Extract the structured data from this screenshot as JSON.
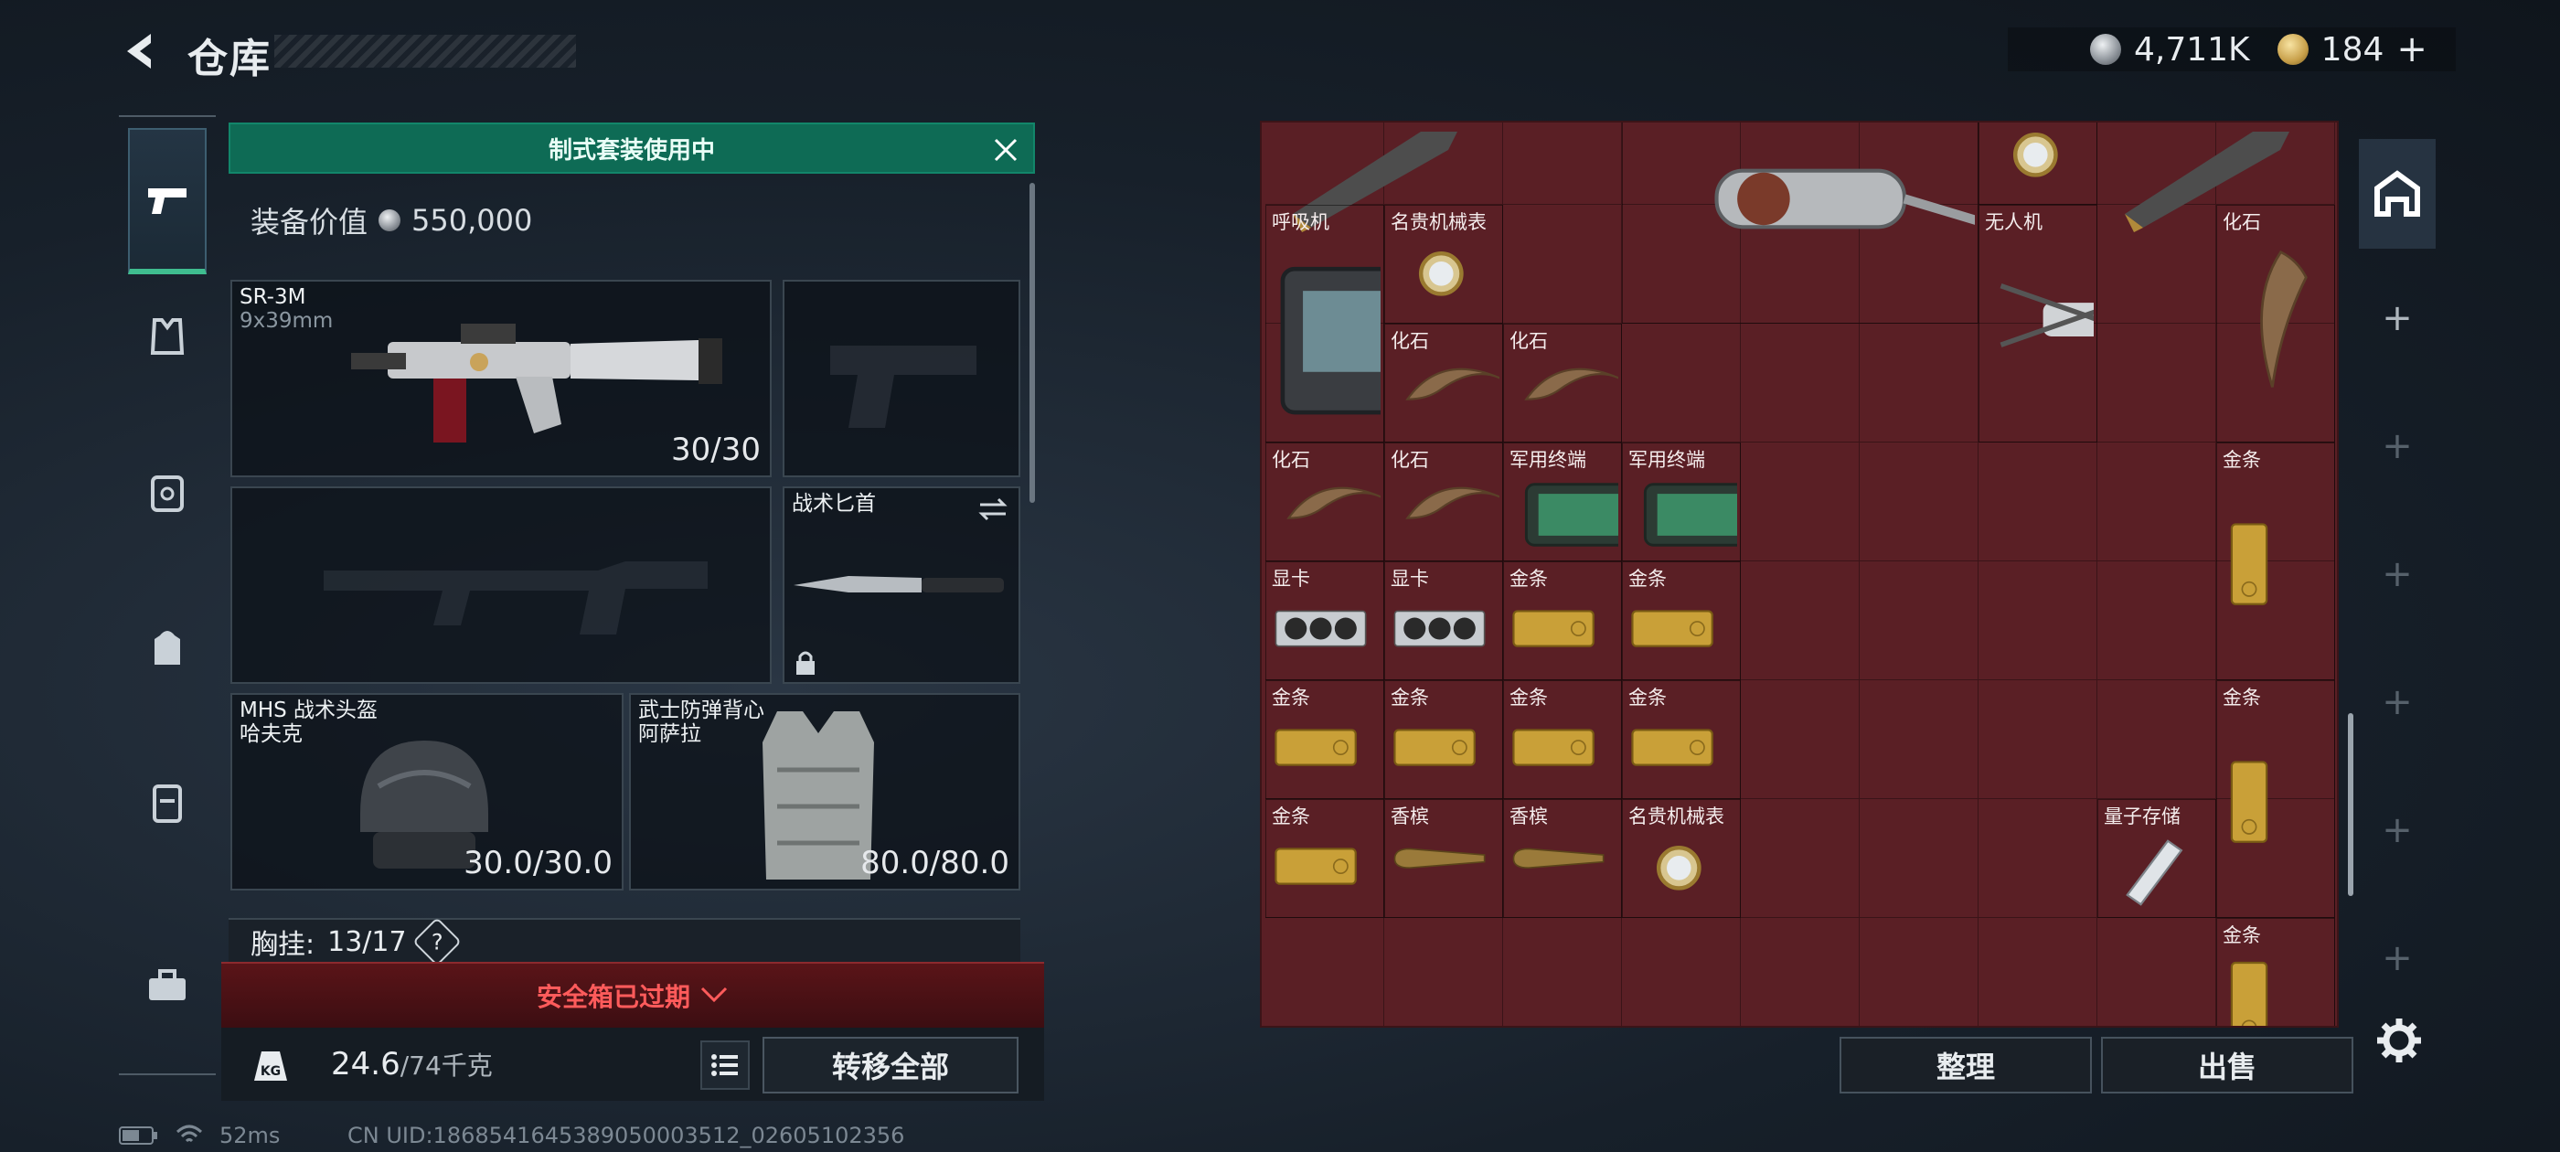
{
  "header": {
    "title": "仓库",
    "currency_silver": "4,711K",
    "currency_gold": "184"
  },
  "nav": [
    "firearm",
    "armor",
    "safe-box",
    "backpack",
    "chest-rig",
    "toolbox"
  ],
  "loadout": {
    "banner": "制式套装使用中",
    "equip_value_label": "装备价值",
    "equip_value": "550,000",
    "primary": {
      "name": "SR-3M",
      "caliber": "9x39mm",
      "ammo": "30/30"
    },
    "knife": {
      "name": "战术匕首"
    },
    "helmet": {
      "name": "MHS 战术头盔",
      "brand": "哈夫克",
      "durability": "30.0/30.0"
    },
    "vest": {
      "name": "武士防弹背心",
      "brand": "阿萨拉",
      "durability": "80.0/80.0"
    },
    "chest_label": "胸挂:",
    "chest_count": "13/17",
    "help": "?",
    "safebox_status": "安全箱已过期",
    "weight": "24.6",
    "weight_max": "/74千克",
    "transfer_all": "转移全部"
  },
  "stash": {
    "items": [
      {
        "label": "强力吸尘器",
        "kind": "vacuum"
      },
      {
        "label": "名贵机械表",
        "kind": "watch"
      },
      {
        "label": "呼吸机",
        "kind": "ventilator"
      },
      {
        "label": "名贵机械表",
        "kind": "watch"
      },
      {
        "label": "无人机",
        "kind": "drone"
      },
      {
        "label": "化石",
        "kind": "fossil-v"
      },
      {
        "label": "化石",
        "kind": "fossil"
      },
      {
        "label": "化石",
        "kind": "fossil"
      },
      {
        "label": "化石",
        "kind": "fossil"
      },
      {
        "label": "化石",
        "kind": "fossil"
      },
      {
        "label": "军用终端",
        "kind": "terminal"
      },
      {
        "label": "军用终端",
        "kind": "terminal"
      },
      {
        "label": "金条",
        "kind": "gold-v"
      },
      {
        "label": "显卡",
        "kind": "gpu"
      },
      {
        "label": "显卡",
        "kind": "gpu"
      },
      {
        "label": "金条",
        "kind": "gold"
      },
      {
        "label": "金条",
        "kind": "gold"
      },
      {
        "label": "金条",
        "kind": "gold"
      },
      {
        "label": "金条",
        "kind": "gold"
      },
      {
        "label": "金条",
        "kind": "gold"
      },
      {
        "label": "金条",
        "kind": "gold"
      },
      {
        "label": "金条",
        "kind": "gold-v"
      },
      {
        "label": "金条",
        "kind": "gold"
      },
      {
        "label": "香槟",
        "kind": "champagne"
      },
      {
        "label": "香槟",
        "kind": "champagne"
      },
      {
        "label": "名贵机械表",
        "kind": "watch"
      },
      {
        "label": "量子存储",
        "kind": "usb"
      },
      {
        "label": "金条",
        "kind": "gold-v"
      }
    ],
    "sort_label": "整理",
    "sell_label": "出售"
  },
  "footer": {
    "ping": "52ms",
    "uid": "CN UID:1868541645389050003512_02605102356"
  },
  "colors": {
    "accent_green": "#0e6b55",
    "stash_bg": "#5a1f25",
    "warning_red": "#ff5b5b"
  }
}
